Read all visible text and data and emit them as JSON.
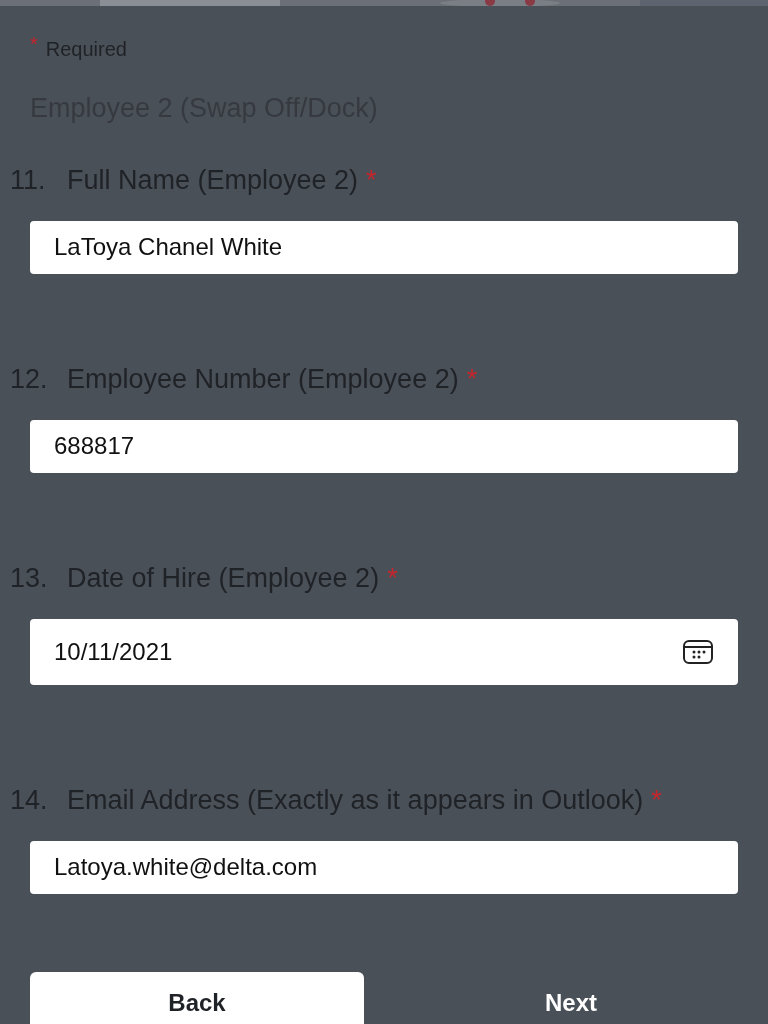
{
  "required_note": {
    "mark": "*",
    "text": "Required"
  },
  "section_title": "Employee 2 (Swap Off/Dock)",
  "questions": [
    {
      "number": "11.",
      "label": "Full Name (Employee 2)",
      "required": true,
      "kind": "text",
      "value": "LaToya Chanel White"
    },
    {
      "number": "12.",
      "label": "Employee Number (Employee 2)",
      "required": true,
      "kind": "text",
      "value": "688817"
    },
    {
      "number": "13.",
      "label": "Date of Hire (Employee 2)",
      "required": true,
      "kind": "date",
      "value": "10/11/2021"
    },
    {
      "number": "14.",
      "label": "Email Address (Exactly as it appears in Outlook)",
      "required": true,
      "kind": "text",
      "value": "Latoya.white@delta.com"
    }
  ],
  "required_mark": "*",
  "buttons": [
    {
      "label": "Back",
      "kind": "secondary"
    },
    {
      "label": "Next",
      "kind": "primary"
    }
  ]
}
